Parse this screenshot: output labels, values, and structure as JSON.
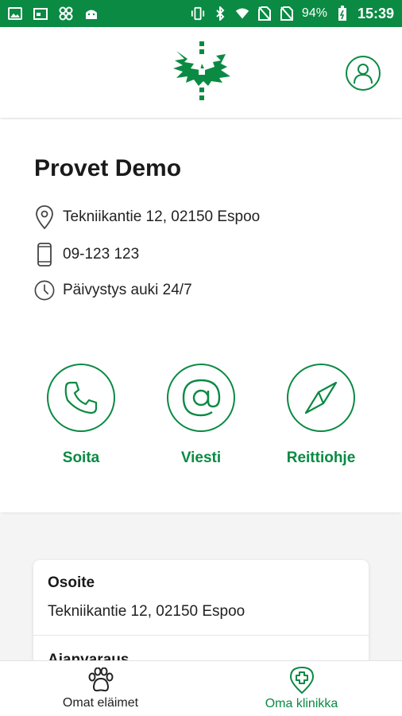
{
  "status_bar": {
    "battery": "94%",
    "time": "15:39",
    "left_icons": [
      "image-icon",
      "calendar-icon",
      "fan-icon",
      "android-icon"
    ],
    "right_icons": [
      "vibrate-icon",
      "bluetooth-icon",
      "wifi-icon",
      "no-sim-icon",
      "no-sim-icon",
      "battery-icon"
    ]
  },
  "header": {
    "logo_icon": "university-tree-logo",
    "profile_icon": "user-icon"
  },
  "clinic": {
    "name": "Provet Demo",
    "address": "Tekniikantie 12, 02150 Espoo",
    "phone": "09-123 123",
    "hours": "Päivystys auki 24/7",
    "actions": [
      {
        "label": "Soita",
        "icon": "phone-icon"
      },
      {
        "label": "Viesti",
        "icon": "at-icon"
      },
      {
        "label": "Reittiohje",
        "icon": "compass-icon"
      }
    ]
  },
  "details": [
    {
      "title": "Osoite",
      "value": "Tekniikantie 12, 02150 Espoo"
    },
    {
      "title": "Ajanvaraus",
      "value": ""
    }
  ],
  "bottom_nav": {
    "items": [
      {
        "label": "Omat eläimet",
        "icon": "paw-icon",
        "active": false
      },
      {
        "label": "Oma klinikka",
        "icon": "clinic-plus-icon",
        "active": true
      }
    ]
  },
  "colors": {
    "brand": "#0a8a43",
    "text": "#1a1a1a",
    "background_lower": "#f4f4f4"
  }
}
